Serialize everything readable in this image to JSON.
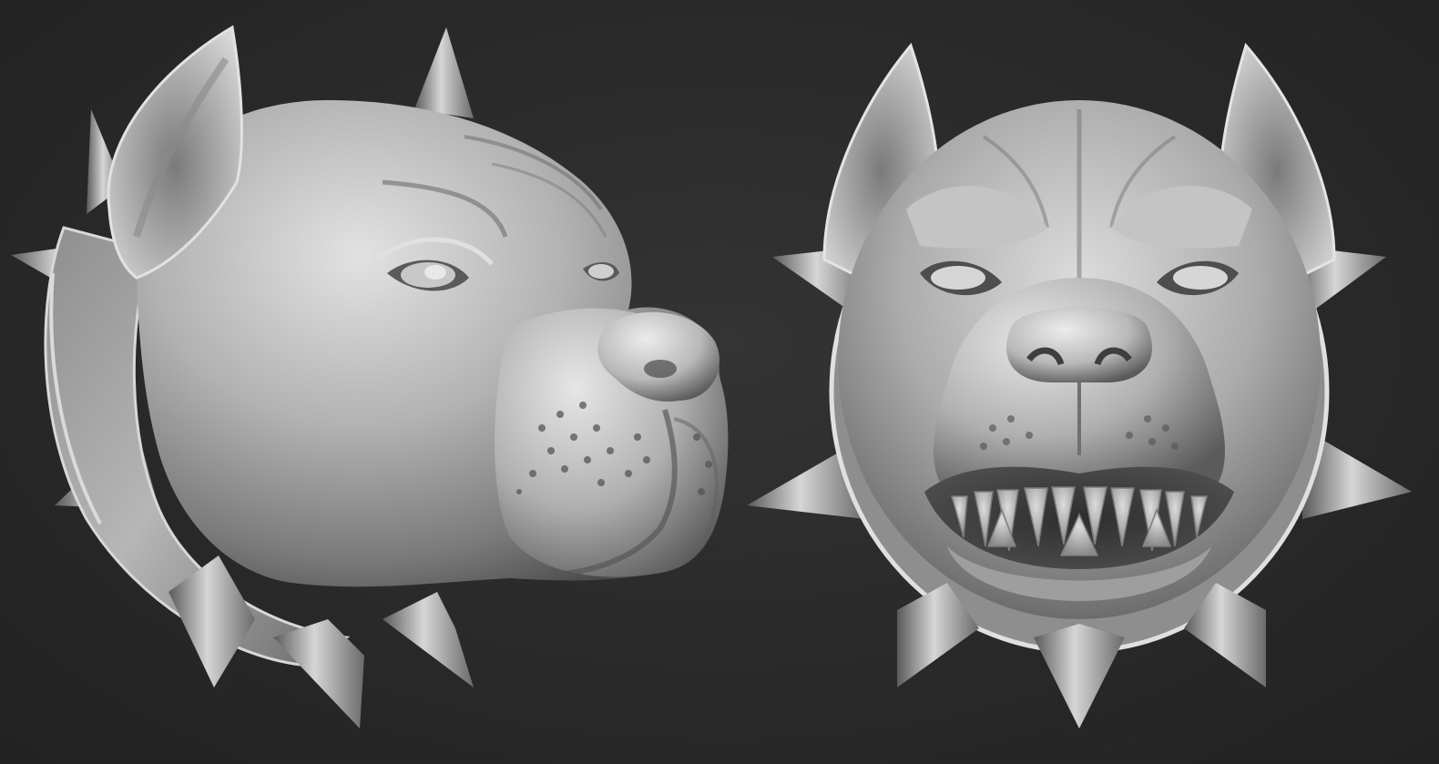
{
  "scene": {
    "subjects": [
      {
        "id": "side",
        "view": "side-profile"
      },
      {
        "id": "front",
        "view": "front"
      }
    ],
    "material": {
      "base": "#a8a8a8",
      "highlight": "#e6e6e6",
      "shadow": "#3e3e3e",
      "background": "#2a2a2a"
    }
  }
}
